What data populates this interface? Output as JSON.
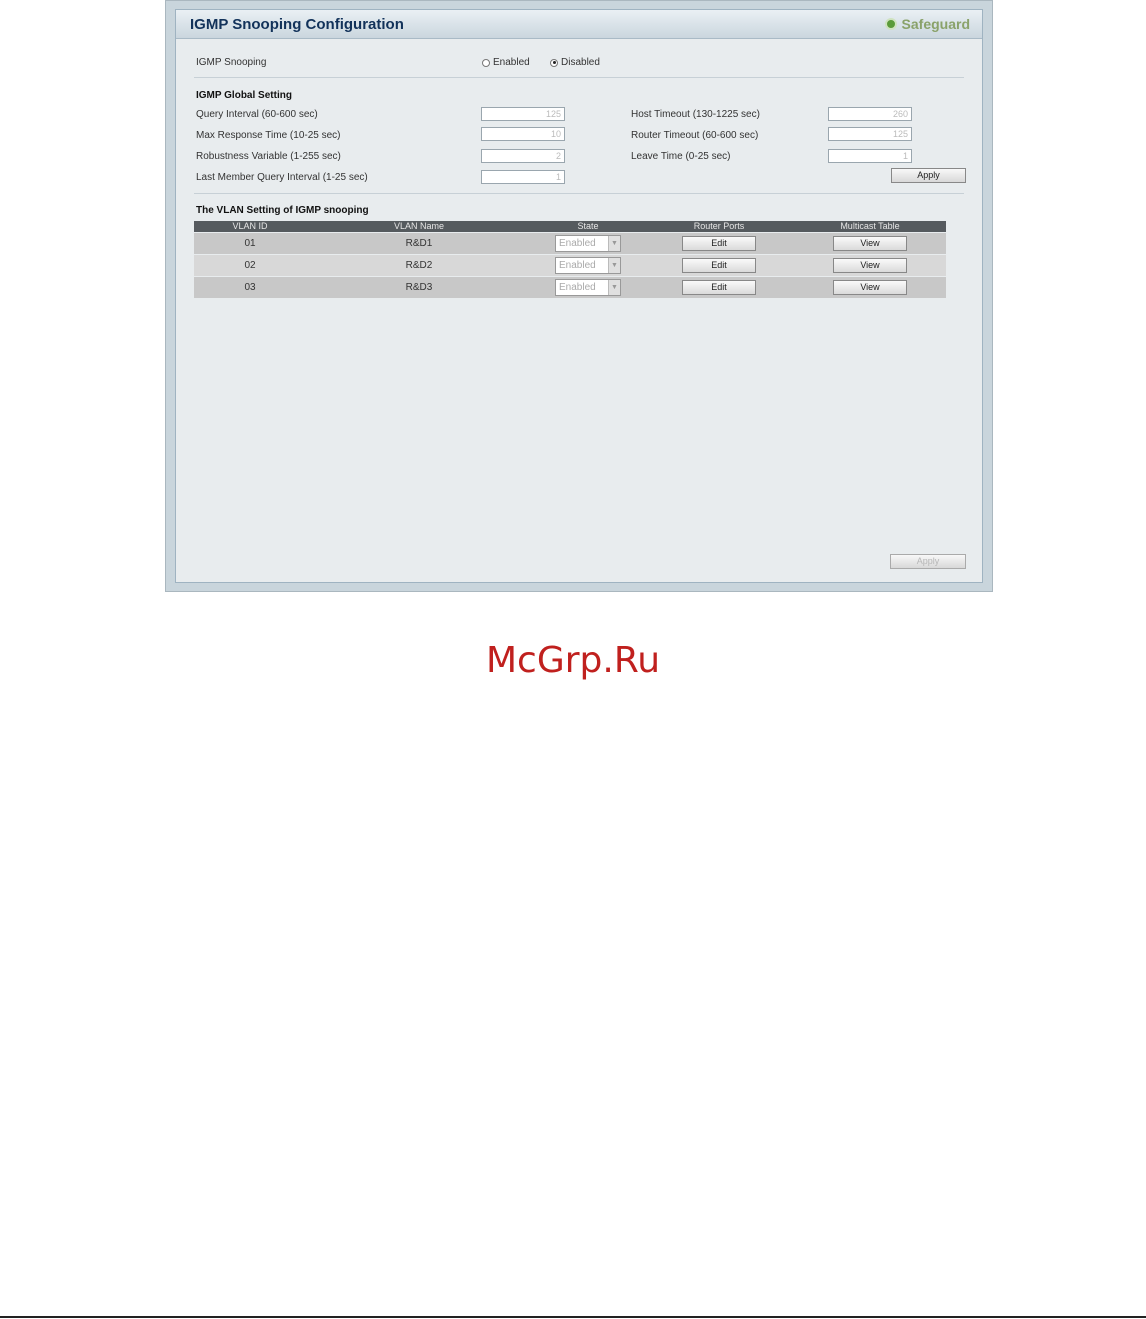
{
  "window": {
    "title": "IGMP Snooping Configuration",
    "brand": "Safeguard",
    "brand_icon": "green-circle-icon"
  },
  "snooping": {
    "label": "IGMP Snooping",
    "options": [
      "Enabled",
      "Disabled"
    ],
    "selected": "Disabled"
  },
  "global": {
    "heading": "IGMP Global Setting",
    "query_interval": {
      "label": "Query Interval (60-600 sec)",
      "value": "125"
    },
    "max_response": {
      "label": "Max Response Time (10-25 sec)",
      "value": "10"
    },
    "robustness": {
      "label": "Robustness Variable (1-255 sec)",
      "value": "2"
    },
    "last_member": {
      "label": "Last Member Query Interval (1-25 sec)",
      "value": "1"
    },
    "host_timeout": {
      "label": "Host Timeout (130-1225 sec)",
      "value": "260"
    },
    "router_timeout": {
      "label": "Router Timeout (60-600 sec)",
      "value": "125"
    },
    "leave_time": {
      "label": "Leave Time (0-25 sec)",
      "value": "1"
    },
    "apply_label": "Apply"
  },
  "vlan": {
    "heading": "The VLAN Setting of IGMP snooping",
    "columns": [
      "VLAN ID",
      "VLAN Name",
      "State",
      "Router Ports",
      "Multicast Table"
    ],
    "rows": [
      {
        "id": "01",
        "name": "R&D1",
        "state": "Enabled",
        "router": "Edit",
        "table": "View"
      },
      {
        "id": "02",
        "name": "R&D2",
        "state": "Enabled",
        "router": "Edit",
        "table": "View"
      },
      {
        "id": "03",
        "name": "R&D3",
        "state": "Enabled",
        "router": "Edit",
        "table": "View"
      }
    ]
  },
  "footer": {
    "apply_label": "Apply"
  },
  "watermark": "McGrp.Ru",
  "colors": {
    "title": "#12325a",
    "brand": "#8aa26a",
    "table_header": "#555a5e",
    "watermark": "#c0201e"
  }
}
